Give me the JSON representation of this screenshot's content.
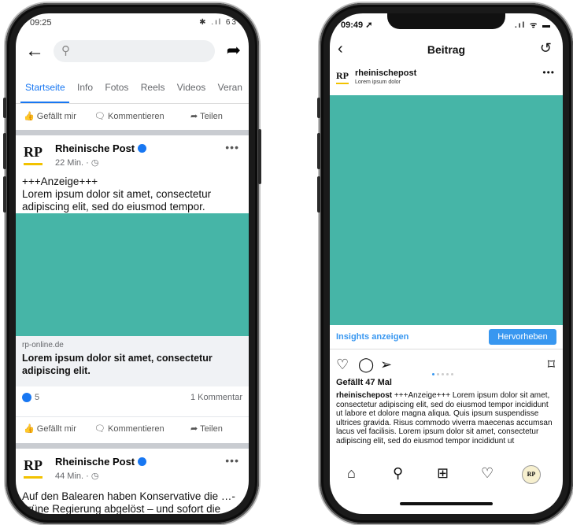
{
  "facebook": {
    "status_time": "09:25",
    "status_icons": "✱ .ıl 63",
    "search_placeholder": "",
    "tabs": [
      "Startseite",
      "Info",
      "Fotos",
      "Reels",
      "Videos",
      "Veran"
    ],
    "actions": {
      "like": "Gefällt mir",
      "comment": "Kommentieren",
      "share": "Teilen"
    },
    "post1": {
      "name": "Rheinische Post",
      "time": "22 Min. · ◷",
      "text": "+++Anzeige+++\nLorem ipsum dolor sit amet, consectetur adipiscing elit, sed do eiusmod tempor.",
      "link_domain": "rp-online.de",
      "link_title": "Lorem ipsum dolor sit amet, consectetur adipiscing elit.",
      "reactions": "5",
      "comments": "1 Kommentar"
    },
    "post2": {
      "name": "Rheinische Post",
      "time": "44 Min. · ◷",
      "text": "Auf den Balearen haben Konservative die …-grüne Regierung abgelöst – und sofort die"
    },
    "logo_text": "RP",
    "colors": {
      "teal": "#46b5a7",
      "blue": "#1877f2"
    }
  },
  "instagram": {
    "status_time": "09:49 ➚",
    "status_icons": ".ıl ᯤ ▬",
    "title": "Beitrag",
    "account": "rheinischepost",
    "account_sub": "Lorem ipsum dolor",
    "insights": "Insights anzeigen",
    "promote": "Hervorheben",
    "likes": "Gefällt 47 Mal",
    "caption_user": "rheinischepost",
    "caption": "+++Anzeige+++ Lorem ipsum dolor sit amet, consectetur adipiscing elit, sed do eiusmod tempor incididunt ut labore et dolore magna aliqua. Quis ipsum suspendisse ultrices gravida. Risus commodo viverra maecenas accumsan lacus vel facilisis. Lorem ipsum dolor sit amet, consectetur adipiscing elit, sed do eiusmod tempor incididunt ut",
    "logo_text": "RP",
    "profile_logo": "RP"
  }
}
